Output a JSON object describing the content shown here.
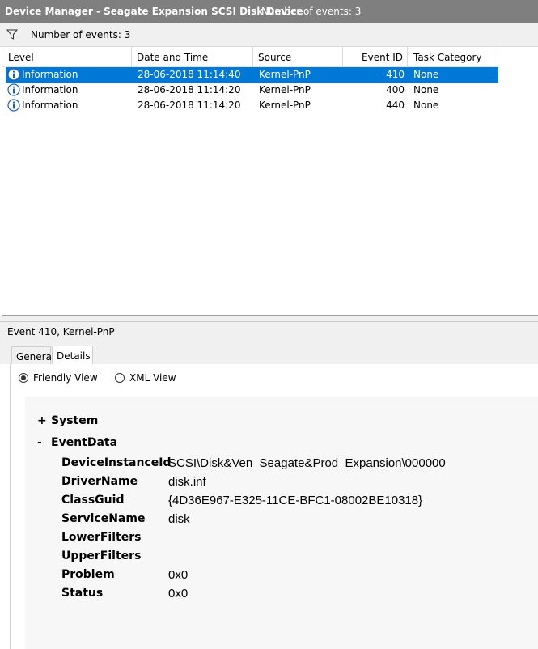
{
  "window": {
    "title": "Device Manager - Seagate Expansion SCSI Disk Device",
    "event_count": "Number of events: 3"
  },
  "filter": {
    "icon": "filter-icon",
    "text": "Number of events: 3"
  },
  "events_table": {
    "columns": [
      "Level",
      "Date and Time",
      "Source",
      "Event ID",
      "Task Category"
    ],
    "rows": [
      {
        "level": "Information",
        "date_time": "28-06-2018 11:14:40",
        "source": "Kernel-PnP",
        "event_id": "410",
        "task_category": "None",
        "selected": true
      },
      {
        "level": "Information",
        "date_time": "28-06-2018 11:14:20",
        "source": "Kernel-PnP",
        "event_id": "400",
        "task_category": "None",
        "selected": false
      },
      {
        "level": "Information",
        "date_time": "28-06-2018 11:14:20",
        "source": "Kernel-PnP",
        "event_id": "440",
        "task_category": "None",
        "selected": false
      }
    ]
  },
  "event_header": "Event 410, Kernel-PnP",
  "tabs": [
    {
      "label": "General",
      "active": false
    },
    {
      "label": "Details",
      "active": true
    }
  ],
  "view_options": {
    "friendly": {
      "label": "Friendly View",
      "checked": true
    },
    "xml": {
      "label": "XML View",
      "checked": false
    }
  },
  "details": {
    "system": {
      "sign": "+",
      "label": "System"
    },
    "eventdata": {
      "sign": "-",
      "label": "EventData"
    },
    "fields": [
      {
        "key": "DeviceInstanceId",
        "value": "SCSI\\Disk&Ven_Seagate&Prod_Expansion\\000000"
      },
      {
        "key": "DriverName",
        "value": "disk.inf"
      },
      {
        "key": "ClassGuid",
        "value": "{4D36E967-E325-11CE-BFC1-08002BE10318}"
      },
      {
        "key": "ServiceName",
        "value": "disk"
      },
      {
        "key": "LowerFilters",
        "value": ""
      },
      {
        "key": "UpperFilters",
        "value": ""
      },
      {
        "key": "Problem",
        "value": "0x0"
      },
      {
        "key": "Status",
        "value": "0x0"
      }
    ]
  },
  "colors": {
    "selection": "#0078d7",
    "titlebar": "#7f7f7f",
    "info_icon": "#1f5fae"
  }
}
